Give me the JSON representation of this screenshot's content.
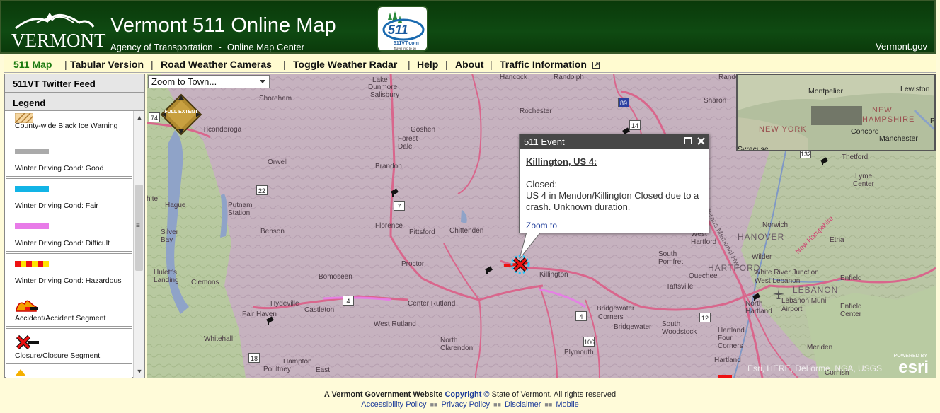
{
  "header": {
    "state_word": "VERMONT",
    "title": "Vermont 511 Online Map",
    "agency": "Agency of Transportation",
    "separator": "-",
    "subtitle": "Online Map Center",
    "logo511_text": "511",
    "logo511_url": "511VT.com",
    "logo511_tag": "Travel info to go",
    "vtgov": "Vermont.gov"
  },
  "nav": {
    "items": [
      "511 Map",
      "Tabular Version",
      "Road Weather Cameras",
      "Toggle Weather Radar",
      "Help",
      "About",
      "Traffic Information"
    ],
    "divider": "|",
    "active": "511 Map"
  },
  "sidebar": {
    "twitter": "511VT Twitter Feed",
    "legend": "Legend",
    "items": [
      {
        "label": "County-wide Black Ice Warning",
        "swatch": "ice-hatch"
      },
      {
        "label": "Winter Driving Cond: Good",
        "swatch": "#aaaaaa"
      },
      {
        "label": "Winter Driving Cond: Fair",
        "swatch": "#12b4e6"
      },
      {
        "label": "Winter Driving Cond: Difficult",
        "swatch": "#e87be8"
      },
      {
        "label": "Winter Driving Cond: Hazardous",
        "swatch": "red-yellow-dash"
      },
      {
        "label": "Accident/Accident Segment",
        "swatch": "accident-icon"
      },
      {
        "label": "Closure/Closure Segment",
        "swatch": "closure-icon"
      }
    ]
  },
  "map": {
    "zoom_select": "Zoom to Town...",
    "full_extent": "FULL EXTENT",
    "places": [
      [
        "Hancock",
        706,
        0
      ],
      [
        "Randolph",
        782,
        0
      ],
      [
        "Randolph",
        1015,
        0
      ],
      [
        "Lake",
        526,
        4
      ],
      [
        "Dunmore",
        520,
        14
      ],
      [
        "Salisbury",
        523,
        25
      ],
      [
        "Shoreham",
        366,
        30
      ],
      [
        "Rochester",
        734,
        48
      ],
      [
        "Sharon",
        994,
        33
      ],
      [
        "Goshen",
        580,
        74
      ],
      [
        "Forest",
        562,
        87
      ],
      [
        "Dale",
        562,
        98
      ],
      [
        "Ticonderoga",
        286,
        74
      ],
      [
        "Orwell",
        378,
        120
      ],
      [
        "Brandon",
        530,
        126
      ],
      [
        "Putnam",
        322,
        181
      ],
      [
        "Station",
        322,
        192
      ],
      [
        "Hague",
        233,
        181
      ],
      [
        "Silver",
        227,
        219
      ],
      [
        "Bay",
        227,
        230
      ],
      [
        "Benson",
        368,
        218
      ],
      [
        "Florence",
        530,
        210
      ],
      [
        "Pittsford",
        578,
        219
      ],
      [
        "Chittenden",
        635,
        217
      ],
      [
        "Proctor",
        567,
        264
      ],
      [
        "Hulett's",
        217,
        276
      ],
      [
        "Landing",
        217,
        287
      ],
      [
        "Clemons",
        270,
        290
      ],
      [
        "Bomoseen",
        450,
        282
      ],
      [
        "Killington",
        762,
        279
      ],
      [
        "South",
        930,
        250
      ],
      [
        "Pomfret",
        930,
        261
      ],
      [
        "West",
        976,
        222
      ],
      [
        "Hartford",
        976,
        233
      ],
      [
        "Norwich",
        1077,
        209
      ],
      [
        "Quechee",
        973,
        281
      ],
      [
        "Taftsville",
        941,
        296
      ],
      [
        "Hydeville",
        382,
        320
      ],
      [
        "Castleton",
        430,
        329
      ],
      [
        "Center Rutland",
        576,
        320
      ],
      [
        "West Rutland",
        528,
        349
      ],
      [
        "Bridgewater",
        843,
        327
      ],
      [
        "Corners",
        845,
        339
      ],
      [
        "Bridgewater",
        867,
        353
      ],
      [
        "South",
        935,
        349
      ],
      [
        "Woodstock",
        935,
        360
      ],
      [
        "Fair Haven",
        342,
        335
      ],
      [
        "Whitehall",
        288,
        370
      ],
      [
        "North",
        622,
        372
      ],
      [
        "Clarendon",
        622,
        383
      ],
      [
        "Plymouth",
        797,
        389
      ],
      [
        "Hampton",
        400,
        402
      ],
      [
        "Poultney",
        372,
        413
      ],
      [
        "East",
        446,
        414
      ],
      [
        "Hartland",
        1014,
        358
      ],
      [
        "Four",
        1014,
        369
      ],
      [
        "Corners",
        1014,
        380
      ],
      [
        "Meriden",
        1140,
        382
      ],
      [
        "Hartland",
        1009,
        400
      ],
      [
        "Etna",
        1172,
        230
      ],
      [
        "Wilder",
        1062,
        254
      ],
      [
        "White River Junction",
        1065,
        276
      ],
      [
        "West Lebanon",
        1066,
        288
      ],
      [
        "North",
        1053,
        320
      ],
      [
        "Hartland",
        1053,
        331
      ],
      [
        "Lebanon Muni",
        1104,
        316
      ],
      [
        "Airport",
        1104,
        328
      ],
      [
        "Enfield",
        1187,
        284
      ],
      [
        "Enfield",
        1187,
        324
      ],
      [
        "Center",
        1187,
        335
      ],
      [
        "Thetford",
        1189,
        113
      ],
      [
        "Lyme",
        1208,
        140
      ],
      [
        "Center",
        1205,
        151
      ],
      [
        "Cornish",
        1165,
        418
      ],
      [
        "hite",
        207,
        172
      ]
    ],
    "big_places": [
      [
        "HANOVER",
        1042,
        226
      ],
      [
        "HARTFORD",
        1000,
        270
      ],
      [
        "LEBANON",
        1120,
        301
      ]
    ],
    "road_label_veterans": "Veterans Memorial Hwy",
    "road_label_nh": "New Hampshire",
    "shields": [
      [
        "74",
        210,
        55
      ],
      [
        "89",
        873,
        34
      ],
      [
        "14",
        889,
        66
      ],
      [
        "22",
        362,
        158
      ],
      [
        "7",
        556,
        180
      ],
      [
        "4",
        484,
        314
      ],
      [
        "4",
        813,
        336
      ],
      [
        "12",
        988,
        338
      ],
      [
        "106",
        824,
        372
      ],
      [
        "18",
        351,
        395
      ],
      [
        "132",
        1130,
        106
      ]
    ],
    "overview": {
      "places": [
        [
          "Montpelier",
          100,
          17
        ],
        [
          "Lewiston",
          230,
          14
        ],
        [
          "Concord",
          160,
          74
        ],
        [
          "Manchester",
          200,
          84
        ],
        [
          "Port",
          272,
          59
        ],
        [
          "Syracuse",
          0,
          99
        ]
      ],
      "states": [
        [
          "NEW",
          190,
          44
        ],
        [
          "HAMPSHIRE",
          176,
          57
        ],
        [
          "NEW YORK",
          30,
          71
        ]
      ]
    },
    "attribution": "Esri, HERE, DeLorme, NGA, USGS",
    "esri_powered": "POWERED BY",
    "esri_name": "esri"
  },
  "popup": {
    "title": "511 Event",
    "heading": "Killington, US 4:",
    "status": "Closed:",
    "description": "US 4 in Mendon/Killington Closed due to a crash. Unknown duration.",
    "zoom_link": "Zoom to"
  },
  "footer": {
    "prefix": "A Vermont Government Website",
    "copyright_link": "Copyright ©",
    "suffix": "State of Vermont. All rights reserved",
    "links": [
      "Accessibility Policy",
      "Privacy Policy",
      "Disclaimer",
      "Mobile"
    ]
  }
}
